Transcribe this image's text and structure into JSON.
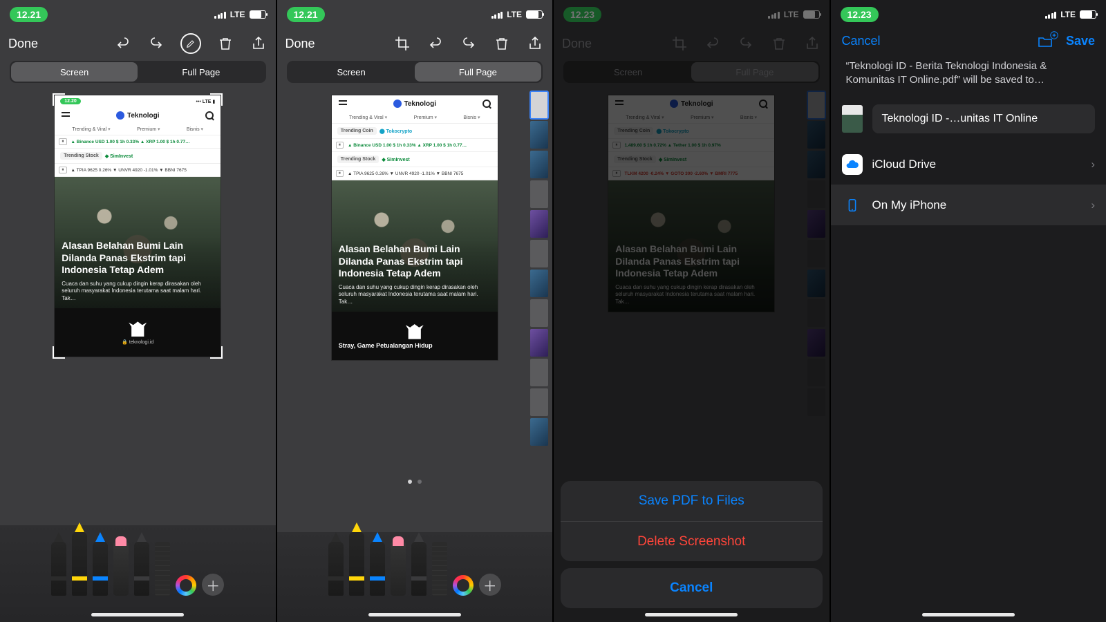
{
  "status": {
    "time1": "12.21",
    "time2": "12.21",
    "time3": "12.23",
    "time4": "12.23",
    "signal": "LTE"
  },
  "toolbar": {
    "done": "Done"
  },
  "segmented": {
    "screen": "Screen",
    "full_page": "Full Page"
  },
  "page": {
    "mini_time": "12.20",
    "mini_signal": "LTE",
    "brand": "Teknologi",
    "tabs": {
      "t1": "Trending & Viral",
      "t2": "Premium",
      "t3": "Bisnis"
    },
    "trending_coin_label": "Trending Coin",
    "trending_coin_chip": "⬤ Tokocrypto",
    "trending_stock_label": "Trending Stock",
    "trending_stock_chip": "◆ SimInvest",
    "ticker1": "▲  Binance USD 1.00 $  1h 0.33%   ▲   XRP 1.00 $ 1h 0.77…",
    "ticker2": "▲  TPIA 9625  0.26%   ▼   UNVR 4920 -1.01%   ▼   BBNI 7675",
    "ticker3": "1,489.60 $  1h 0.72%   ▲  Tether 1.00 $  1h 0.97%",
    "ticker4": "TLKM 4200 -0.24%  ▼  GOTO 300 -2.60%  ▼  BMRI 7775",
    "headline": "Alasan Belahan Bumi Lain Dilanda Panas Ekstrim tapi Indonesia Tetap Adem",
    "sub": "Cuaca dan suhu yang cukup dingin kerap dirasakan oleh seluruh masyarakat Indonesia terutama saat malam hari. Tak…",
    "url": "🔒 teknologi.id",
    "stray": "Stray, Game Petualangan Hidup"
  },
  "sheet": {
    "save_pdf": "Save PDF to Files",
    "delete": "Delete Screenshot",
    "cancel": "Cancel"
  },
  "files": {
    "cancel": "Cancel",
    "save": "Save",
    "desc": "“Teknologi ID - Berita Teknologi Indonesia & Komunitas IT Online.pdf” will be saved to…",
    "filename": "Teknologi ID -…unitas IT Online",
    "icloud": "iCloud Drive",
    "on_phone": "On My iPhone"
  }
}
